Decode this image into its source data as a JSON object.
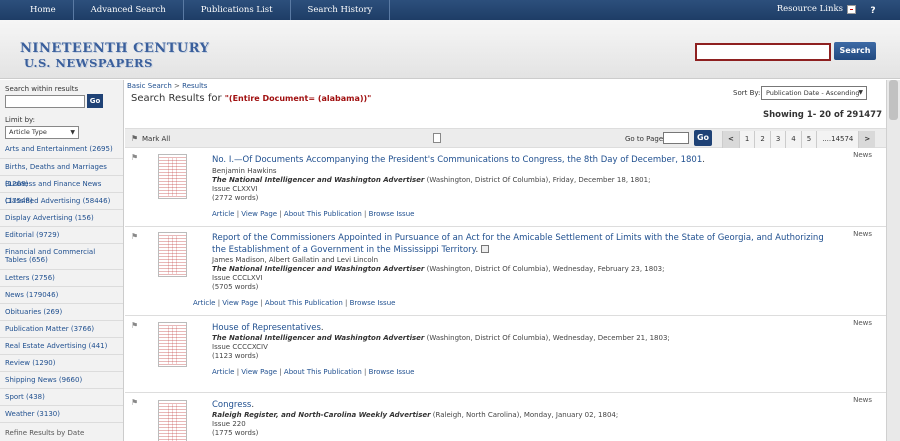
{
  "topnav": {
    "items": [
      "Home",
      "Advanced Search",
      "Publications List",
      "Search History"
    ],
    "resource_links": "Resource Links",
    "help": "?"
  },
  "header": {
    "logo_line1": "NINETEENTH CENTURY",
    "logo_line2": "U.S. NEWSPAPERS",
    "search_value": "",
    "search_button": "Search"
  },
  "sidebar": {
    "search_within_label": "Search within results",
    "search_within_value": "",
    "go_label": "Go",
    "limit_by_label": "Limit by:",
    "type_select": "Article Type",
    "facets": [
      "Arts and Entertainment (2695)",
      "Births, Deaths and Marriages (1268)",
      "Business and Finance News (17548)",
      "Classified Advertising (58446)",
      "Display Advertising (156)",
      "Editorial (9729)",
      "Financial and Commercial Tables (656)",
      "Letters (2756)",
      "News (179046)",
      "Obituaries (269)",
      "Publication Matter (3766)",
      "Real Estate Advertising (441)",
      "Review (1290)",
      "Shipping News (9660)",
      "Sport (438)",
      "Weather (3130)"
    ],
    "refine_by_date": "Refine Results by Date"
  },
  "main": {
    "breadcrumb": {
      "basic": "Basic Search",
      "sep": ">",
      "current": "Results"
    },
    "results_label": "Search Results for",
    "query": "\"(Entire Document= (alabama))\"",
    "sort_by_label": "Sort By:",
    "sort_value": "Publication Date - Ascending",
    "showing": "Showing 1- 20 of 291477",
    "mark_all": "Mark All",
    "goto_label": "Go to Page:",
    "goto_value": "",
    "go_label": "Go",
    "pager": [
      "<",
      "1",
      "2",
      "3",
      "4",
      "5",
      "....14574",
      ">"
    ]
  },
  "results": [
    {
      "title": "No. I.—Of Documents Accompanying the President's Communications to Congress, the 8th Day of December, 1801",
      "author": "Benjamin Hawkins",
      "publication": "The National Intelligencer and Washington Advertiser",
      "place_date": "(Washington, District Of Columbia),  Friday, December 18, 1801;",
      "issue": "Issue CLXXVI",
      "words": "(2772 words)",
      "links": [
        "Article",
        "View Page",
        "About This Publication",
        "Browse Issue"
      ],
      "type": "News"
    },
    {
      "title": "Report of the Commissioners Appointed in Pursuance of an Act for the Amicable Settlement of Limits with the State of Georgia, and Authorizing the Establishment of a Government in the Mississippi Territory",
      "author": "James Madison, Albert Gallatin and Levi Lincoln",
      "publication": "The National Intelligencer and Washington Advertiser",
      "place_date": "(Washington, District Of Columbia),  Wednesday, February 23, 1803;",
      "issue": "Issue CCCLXVI",
      "words": "(5705 words)",
      "links": [
        "Article",
        "View Page",
        "About This Publication",
        "Browse Issue"
      ],
      "type": "News"
    },
    {
      "title": "House of Representatives",
      "publication": "The National Intelligencer and Washington Advertiser",
      "place_date": "(Washington, District Of Columbia),  Wednesday, December 21, 1803;",
      "issue": "Issue CCCCXCIV",
      "words": "(1123 words)",
      "links": [
        "Article",
        "View Page",
        "About This Publication",
        "Browse Issue"
      ],
      "type": "News"
    },
    {
      "title": "Congress",
      "publication": "Raleigh Register, and North-Carolina Weekly Advertiser",
      "place_date": "(Raleigh, North Carolina),  Monday, January 02, 1804;",
      "issue": "Issue 220",
      "words": "(1775 words)",
      "type": "News"
    }
  ]
}
